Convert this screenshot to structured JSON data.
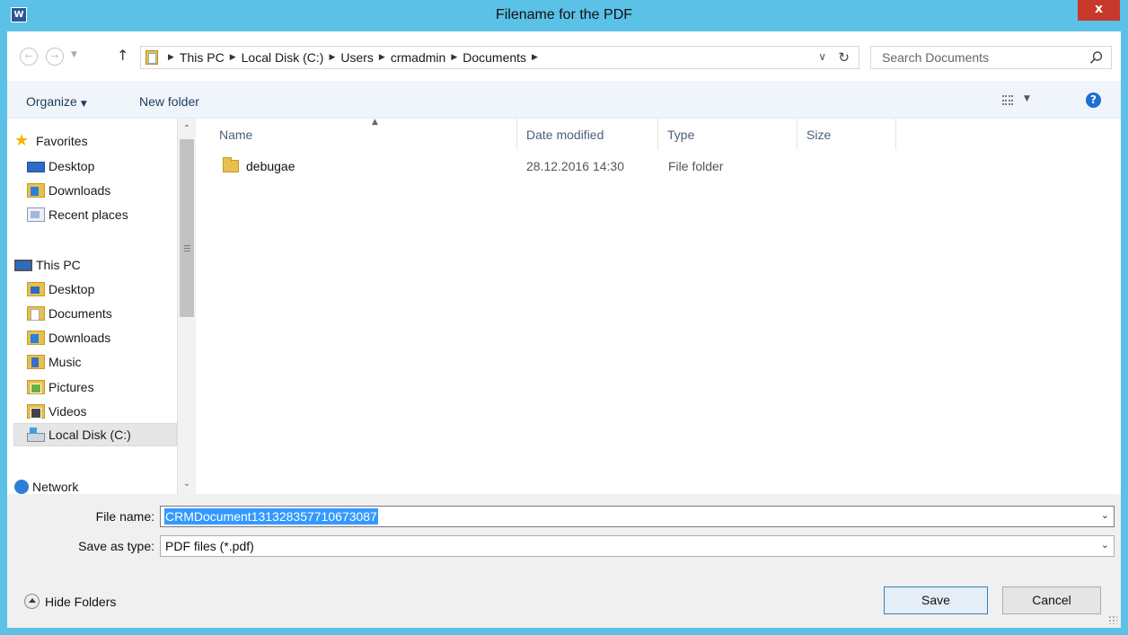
{
  "window": {
    "title": "Filename for the PDF",
    "app_icon": "word-icon",
    "close_label": "x",
    "accent_color": "#5bc1e6",
    "close_color": "#c7392b"
  },
  "address": {
    "crumbs": [
      "This PC",
      "Local Disk (C:)",
      "Users",
      "crmadmin",
      "Documents"
    ]
  },
  "search": {
    "placeholder": "Search Documents"
  },
  "commandbar": {
    "organize_label": "Organize",
    "new_folder_label": "New folder",
    "help_label": "?"
  },
  "navpane": {
    "items": [
      {
        "label": "Favorites",
        "icon": "star-icon"
      },
      {
        "label": "Desktop",
        "icon": "desktop-icon"
      },
      {
        "label": "Downloads",
        "icon": "downloads-folder-icon"
      },
      {
        "label": "Recent places",
        "icon": "recent-places-icon"
      },
      {
        "label": "This PC",
        "icon": "computer-icon"
      },
      {
        "label": "Desktop",
        "icon": "desktop-folder-icon"
      },
      {
        "label": "Documents",
        "icon": "documents-folder-icon"
      },
      {
        "label": "Downloads",
        "icon": "downloads-folder-icon"
      },
      {
        "label": "Music",
        "icon": "music-folder-icon"
      },
      {
        "label": "Pictures",
        "icon": "pictures-folder-icon"
      },
      {
        "label": "Videos",
        "icon": "videos-folder-icon"
      },
      {
        "label": "Local Disk (C:)",
        "icon": "local-disk-icon",
        "selected": true
      },
      {
        "label": "Network",
        "icon": "network-icon"
      }
    ]
  },
  "filelist": {
    "columns": [
      "Name",
      "Date modified",
      "Type",
      "Size"
    ],
    "sorted_by": "Name",
    "rows": [
      {
        "name": "debugae",
        "date_modified": "28.12.2016 14:30",
        "type": "File folder",
        "size": ""
      }
    ]
  },
  "form": {
    "file_name_label": "File name:",
    "file_name_value": "CRMDocument131328357710673087",
    "save_type_label": "Save as type:",
    "save_type_value": "PDF files (*.pdf)"
  },
  "footer": {
    "hide_folders_label": "Hide Folders",
    "save_label": "Save",
    "cancel_label": "Cancel"
  }
}
